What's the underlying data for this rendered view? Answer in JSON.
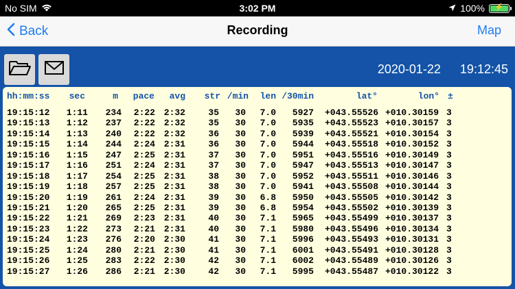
{
  "status_bar": {
    "carrier": "No SIM",
    "time": "3:02 PM",
    "battery": "100%",
    "battery_level": 1.0
  },
  "nav": {
    "back_label": "Back",
    "title": "Recording",
    "right_label": "Map"
  },
  "toolbar": {
    "open_icon": "folder-open-icon",
    "mail_icon": "envelope-icon"
  },
  "header_info": {
    "date": "2020-01-22",
    "time": "19:12:45"
  },
  "table": {
    "columns": [
      "hh:mm:ss",
      "sec",
      "m",
      "pace",
      "avg",
      "str",
      "/min",
      "len",
      "/30min",
      "lat°",
      "lon°",
      "±"
    ],
    "rows": [
      [
        "19:15:12",
        "1:11",
        "234",
        "2:22",
        "2:32",
        "35",
        "30",
        "7.0",
        "5927",
        "+043.55526",
        "+010.30159",
        "3"
      ],
      [
        "19:15:13",
        "1:12",
        "237",
        "2:22",
        "2:32",
        "35",
        "30",
        "7.0",
        "5935",
        "+043.55523",
        "+010.30157",
        "3"
      ],
      [
        "19:15:14",
        "1:13",
        "240",
        "2:22",
        "2:32",
        "36",
        "30",
        "7.0",
        "5939",
        "+043.55521",
        "+010.30154",
        "3"
      ],
      [
        "19:15:15",
        "1:14",
        "244",
        "2:24",
        "2:31",
        "36",
        "30",
        "7.0",
        "5944",
        "+043.55518",
        "+010.30152",
        "3"
      ],
      [
        "19:15:16",
        "1:15",
        "247",
        "2:25",
        "2:31",
        "37",
        "30",
        "7.0",
        "5951",
        "+043.55516",
        "+010.30149",
        "3"
      ],
      [
        "19:15:17",
        "1:16",
        "251",
        "2:24",
        "2:31",
        "37",
        "30",
        "7.0",
        "5947",
        "+043.55513",
        "+010.30147",
        "3"
      ],
      [
        "19:15:18",
        "1:17",
        "254",
        "2:25",
        "2:31",
        "38",
        "30",
        "7.0",
        "5952",
        "+043.55511",
        "+010.30146",
        "3"
      ],
      [
        "19:15:19",
        "1:18",
        "257",
        "2:25",
        "2:31",
        "38",
        "30",
        "7.0",
        "5941",
        "+043.55508",
        "+010.30144",
        "3"
      ],
      [
        "19:15:20",
        "1:19",
        "261",
        "2:24",
        "2:31",
        "39",
        "30",
        "6.8",
        "5950",
        "+043.55505",
        "+010.30142",
        "3"
      ],
      [
        "19:15:21",
        "1:20",
        "265",
        "2:25",
        "2:31",
        "39",
        "30",
        "6.8",
        "5954",
        "+043.55502",
        "+010.30139",
        "3"
      ],
      [
        "19:15:22",
        "1:21",
        "269",
        "2:23",
        "2:31",
        "40",
        "30",
        "7.1",
        "5965",
        "+043.55499",
        "+010.30137",
        "3"
      ],
      [
        "19:15:23",
        "1:22",
        "273",
        "2:21",
        "2:31",
        "40",
        "30",
        "7.1",
        "5980",
        "+043.55496",
        "+010.30134",
        "3"
      ],
      [
        "19:15:24",
        "1:23",
        "276",
        "2:20",
        "2:30",
        "41",
        "30",
        "7.1",
        "5996",
        "+043.55493",
        "+010.30131",
        "3"
      ],
      [
        "19:15:25",
        "1:24",
        "280",
        "2:21",
        "2:30",
        "41",
        "30",
        "7.1",
        "6001",
        "+043.55491",
        "+010.30128",
        "3"
      ],
      [
        "19:15:26",
        "1:25",
        "283",
        "2:22",
        "2:30",
        "42",
        "30",
        "7.1",
        "6002",
        "+043.55489",
        "+010.30126",
        "3"
      ],
      [
        "19:15:27",
        "1:26",
        "286",
        "2:21",
        "2:30",
        "42",
        "30",
        "7.1",
        "5995",
        "+043.55487",
        "+010.30122",
        "3"
      ]
    ]
  }
}
